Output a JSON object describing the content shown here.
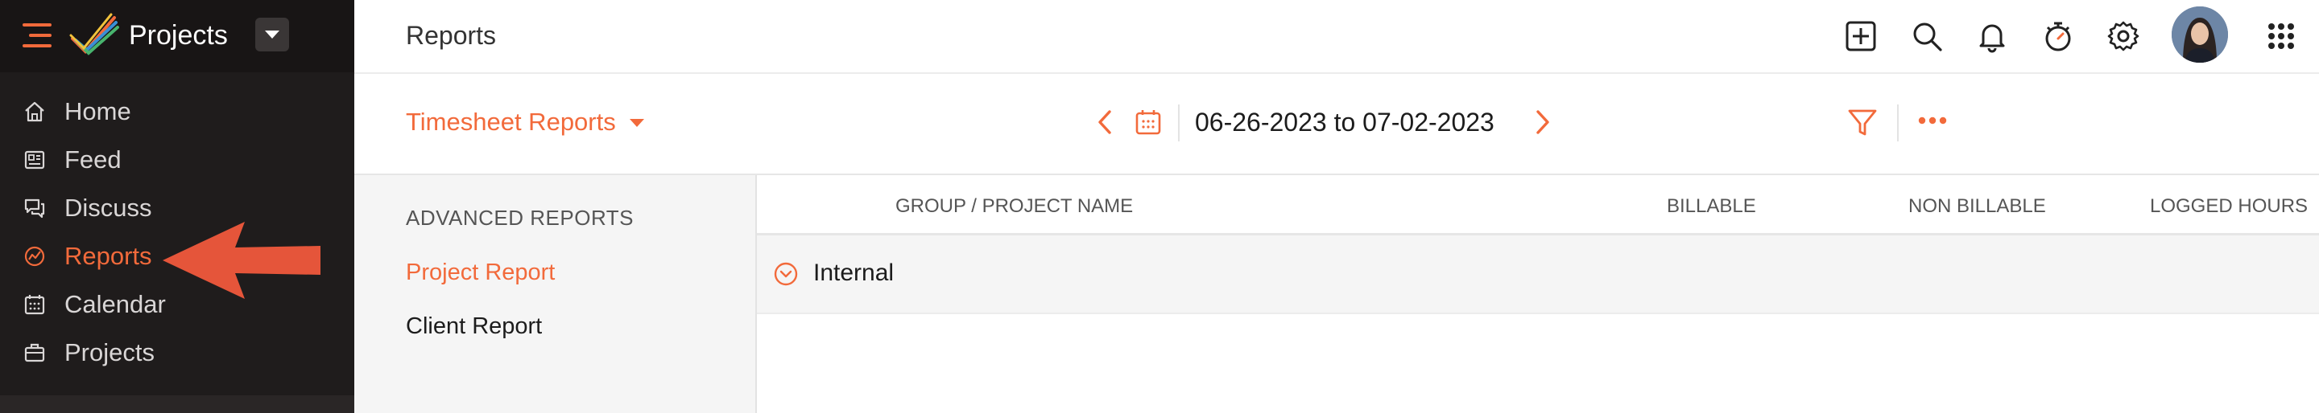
{
  "app": {
    "title": "Projects"
  },
  "sidebar": {
    "items": [
      {
        "label": "Home",
        "icon": "home-icon",
        "active": false
      },
      {
        "label": "Feed",
        "icon": "feed-icon",
        "active": false
      },
      {
        "label": "Discuss",
        "icon": "discuss-icon",
        "active": false
      },
      {
        "label": "Reports",
        "icon": "reports-icon",
        "active": true
      },
      {
        "label": "Calendar",
        "icon": "calendar-icon",
        "active": false
      },
      {
        "label": "Projects",
        "icon": "briefcase-icon",
        "active": false
      }
    ]
  },
  "header": {
    "title": "Reports",
    "icons": [
      "add-icon",
      "search-icon",
      "bell-icon",
      "timer-icon",
      "gear-icon",
      "avatar",
      "apps-grid-icon"
    ]
  },
  "subheader": {
    "report_type": "Timesheet Reports",
    "date_range": "06-26-2023 to 07-02-2023"
  },
  "left_panel": {
    "heading": "ADVANCED REPORTS",
    "items": [
      {
        "label": "Project Report",
        "active": true
      },
      {
        "label": "Client Report",
        "active": false
      }
    ]
  },
  "table": {
    "columns": [
      "GROUP / PROJECT NAME",
      "BILLABLE",
      "NON BILLABLE",
      "LOGGED HOURS"
    ],
    "groups": [
      {
        "name": "Internal"
      }
    ]
  },
  "colors": {
    "accent": "#f26a3b",
    "sidebar_bg": "#1f1c1c",
    "annotation_arrow": "#e5553a"
  }
}
